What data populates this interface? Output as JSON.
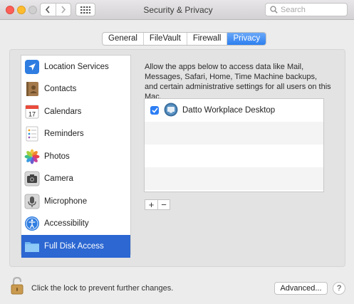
{
  "window": {
    "title": "Security & Privacy"
  },
  "search": {
    "placeholder": "Search"
  },
  "tabs": [
    {
      "label": "General"
    },
    {
      "label": "FileVault"
    },
    {
      "label": "Firewall"
    },
    {
      "label": "Privacy",
      "active": true
    }
  ],
  "sidebar": {
    "items": [
      {
        "label": "Location Services",
        "icon": "location-arrow-icon"
      },
      {
        "label": "Contacts",
        "icon": "contacts-book-icon"
      },
      {
        "label": "Calendars",
        "icon": "calendar-icon"
      },
      {
        "label": "Reminders",
        "icon": "reminders-list-icon"
      },
      {
        "label": "Photos",
        "icon": "photos-flower-icon"
      },
      {
        "label": "Camera",
        "icon": "camera-icon"
      },
      {
        "label": "Microphone",
        "icon": "microphone-icon"
      },
      {
        "label": "Accessibility",
        "icon": "accessibility-icon"
      },
      {
        "label": "Full Disk Access",
        "icon": "folder-icon",
        "selected": true
      }
    ]
  },
  "main": {
    "description": "Allow the apps below to access data like Mail, Messages, Safari, Home, Time Machine backups, and certain administrative settings for all users on this Mac.",
    "apps": [
      {
        "name": "Datto Workplace Desktop",
        "checked": true
      }
    ],
    "add_label": "+",
    "remove_label": "−",
    "calendar_day": "17"
  },
  "footer": {
    "lock_text": "Click the lock to prevent further changes.",
    "advanced_label": "Advanced...",
    "help_label": "?"
  },
  "colors": {
    "accent": "#2c67d2",
    "tab_active": "#2d7ff0",
    "checkbox": "#2c7ef4"
  }
}
